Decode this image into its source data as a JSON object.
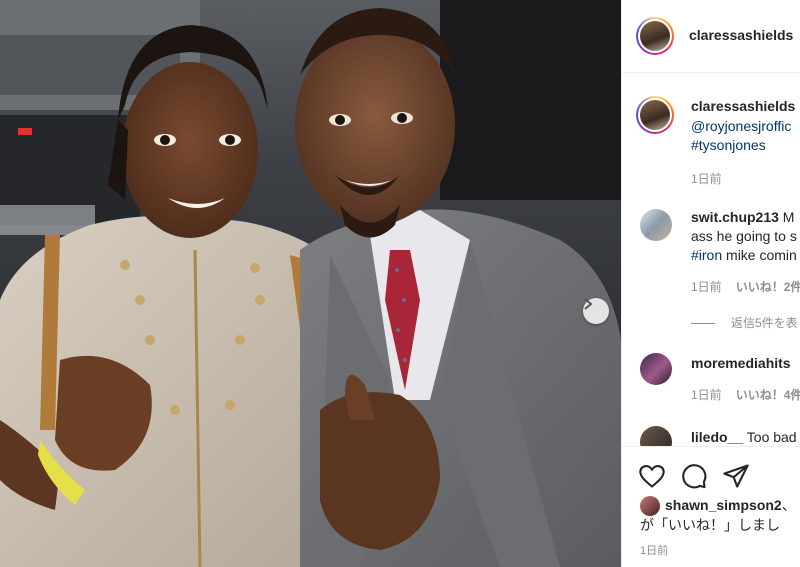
{
  "header": {
    "username": "claressashields"
  },
  "caption": {
    "username": "claressashields",
    "mention": "@royjonesjroffic",
    "hashtag": "#tysonjones",
    "time": "1日前"
  },
  "comments": [
    {
      "username": "swit.chup213",
      "line1_rest": " M",
      "line2": "ass he going to s",
      "hashtag": "#iron",
      "line3_rest": " mike comin",
      "time": "1日前",
      "likes": "いいね！2件"
    },
    {
      "replies": "返信5件を表"
    },
    {
      "username": "moremediahits",
      "time": "1日前",
      "likes": "いいね！4件"
    },
    {
      "username": "liledo__",
      "text": " Too bad"
    }
  ],
  "actions": {
    "like_icon": "heart-icon",
    "comment_icon": "comment-icon",
    "share_icon": "share-icon"
  },
  "liked_by": {
    "username": "shawn_simpson2",
    "suffix": "、",
    "line2": "が「いいね！」しまし",
    "time": "1日前"
  }
}
